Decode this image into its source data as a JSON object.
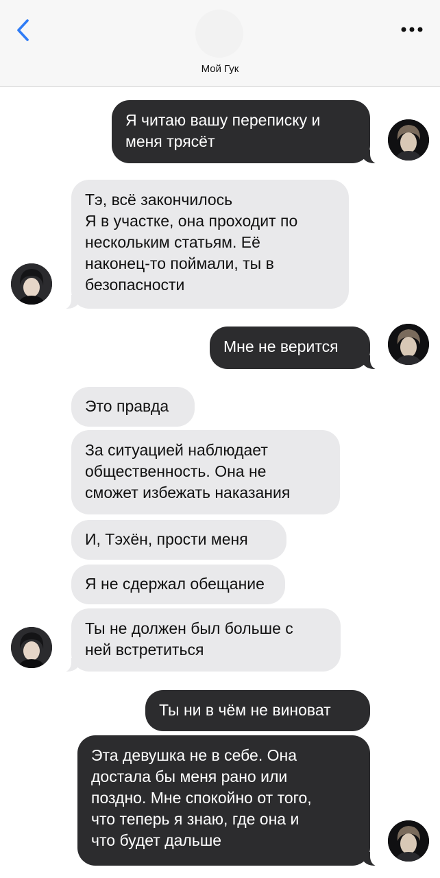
{
  "header": {
    "contact_name": "Мой Гук",
    "back_icon": "chevron-left-icon",
    "more_icon": "ellipsis-icon",
    "accent_color": "#2f7cf6"
  },
  "messages": [
    {
      "sender": "me",
      "text": "Я читаю вашу переписку и\nменя трясёт"
    },
    {
      "sender": "contact",
      "text": "Тэ, всё закончилось\nЯ в участке, она проходит по\nнескольким статьям. Её\nнаконец-то поймали, ты в\nбезопасности"
    },
    {
      "sender": "me",
      "text": "Мне не верится"
    },
    {
      "sender": "contact",
      "text": "Это правда"
    },
    {
      "sender": "contact",
      "text": "За ситуацией наблюдает\nобщественность. Она не\nсможет избежать наказания"
    },
    {
      "sender": "contact",
      "text": "И, Тэхён, прости меня"
    },
    {
      "sender": "contact",
      "text": "Я не сдержал обещание"
    },
    {
      "sender": "contact",
      "text": "Ты не должен был больше с\nней встретиться"
    },
    {
      "sender": "me",
      "text": "Ты ни в чём не виноват"
    },
    {
      "sender": "me",
      "text": "Эта девушка не в себе. Она\nдостала бы меня рано или\nпоздно. Мне спокойно от того,\nчто теперь я знаю, где она и\nчто будет дальше"
    }
  ],
  "colors": {
    "outgoing_bubble": "#2c2c2e",
    "incoming_bubble": "#e9e9eb",
    "header_bg": "#f7f7f7"
  }
}
